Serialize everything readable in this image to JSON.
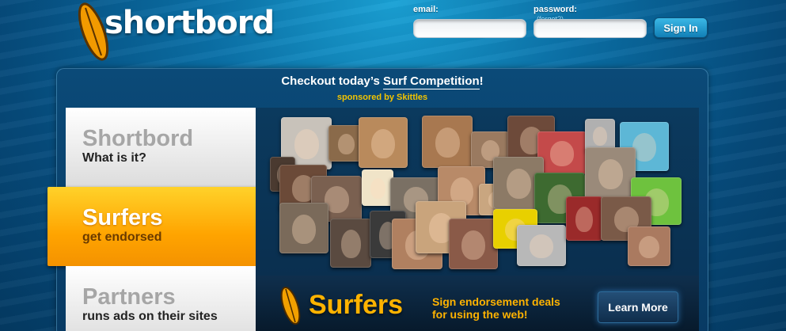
{
  "brand": {
    "name": "shortbord",
    "board_icon": "surfboard-icon"
  },
  "login": {
    "email_label": "email:",
    "password_label": "password:",
    "forgot_label": "(forgot?)",
    "email_value": "",
    "password_value": "",
    "signin_label": "Sign In"
  },
  "promo": {
    "headline_prefix": "Checkout today’s ",
    "headline_link": "Surf Competition",
    "headline_suffix": "!",
    "sponsor": "sponsored by Skittles"
  },
  "tabs": [
    {
      "title": "Shortbord",
      "subtitle": "What is it?"
    },
    {
      "title": "Surfers",
      "subtitle": "get endorsed"
    },
    {
      "title": "Partners",
      "subtitle": "runs ads on their sites"
    }
  ],
  "faces": {
    "icon": "user-photo-icon"
  },
  "banner": {
    "title": "Surfers",
    "line1": "Sign endorsement deals",
    "line2": "for using the web!",
    "button_label": "Learn More"
  },
  "colors": {
    "accent_orange": "#ffa400",
    "banner_gold": "#ffb300",
    "sponsor_yellow": "#f2c300",
    "sky_blue": "#1aa2d6"
  }
}
